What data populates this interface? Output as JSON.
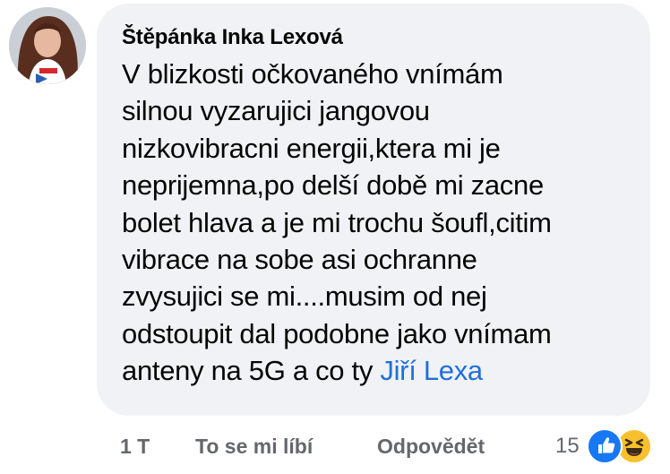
{
  "comment": {
    "author": "Štěpánka Inka Lexová",
    "text_lines": [
      "V blizkosti očkovaného vnímám",
      "silnou vyzarujici jangovou",
      "nizkovibracni energii,ktera mi je",
      "neprijemna,po delší době mi zacne",
      "bolet hlava a je mi trochu šoufl,citim",
      "vibrace na sobe asi ochranne",
      "zvysujici se mi....musim od nej",
      "odstoupit dal podobne jako vnímam",
      "anteny na 5G a co ty "
    ],
    "mention": "Jiří Lexa"
  },
  "actions": {
    "time": "1 T",
    "like_label": "To se mi líbí",
    "reply_label": "Odpovědět"
  },
  "reactions": {
    "count": "15",
    "icons": [
      "like-icon",
      "haha-icon"
    ],
    "like_color": "#1877f2",
    "haha_color": "#f7c02c"
  },
  "colors": {
    "bubble_bg": "#f0f2f5",
    "mention": "#216fdb",
    "meta_text": "#65676b"
  }
}
